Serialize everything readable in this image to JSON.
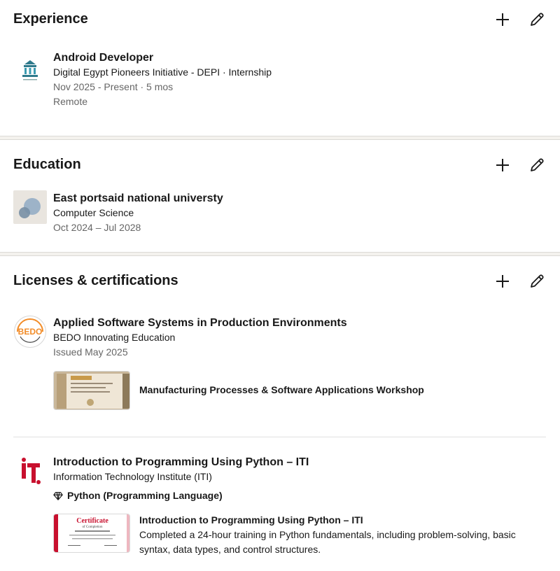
{
  "experience": {
    "title": "Experience",
    "add_label": "add-experience",
    "items": [
      {
        "role": "Android Developer",
        "org": "Digital Egypt Pioneers Initiative - DEPI · Internship",
        "dates": "Nov 2025 - Present · 5 mos",
        "location": "Remote"
      }
    ]
  },
  "education": {
    "title": "Education",
    "items": [
      {
        "school": "East portsaid national universty",
        "field": "Computer Science",
        "dates": "Oct 2024 – Jul 2028"
      }
    ]
  },
  "licenses": {
    "title": "Licenses & certifications",
    "items": [
      {
        "name": "Applied Software Systems in Production Environments",
        "issuer": "BEDO Innovating Education",
        "issued": "Issued May 2025",
        "media_title": "Manufacturing Processes & Software Applications Workshop",
        "logo_text": "BEDO"
      },
      {
        "name": "Introduction to Programming Using Python – ITI",
        "issuer": "Information Technology Institute (ITI)",
        "skill": "Python (Programming Language)",
        "media_title": "Introduction to Programming Using Python – ITI",
        "media_desc": "Completed a 24-hour training in Python fundamentals, including problem-solving, basic syntax, data types, and control structures.",
        "thumb_title": "Certificate",
        "thumb_sub": "of Completion"
      }
    ]
  },
  "colors": {
    "text": "#191919",
    "muted": "#666666",
    "iti_red": "#c8102e",
    "bedo_orange": "#f28c28",
    "separator": "#f4f2ee"
  }
}
